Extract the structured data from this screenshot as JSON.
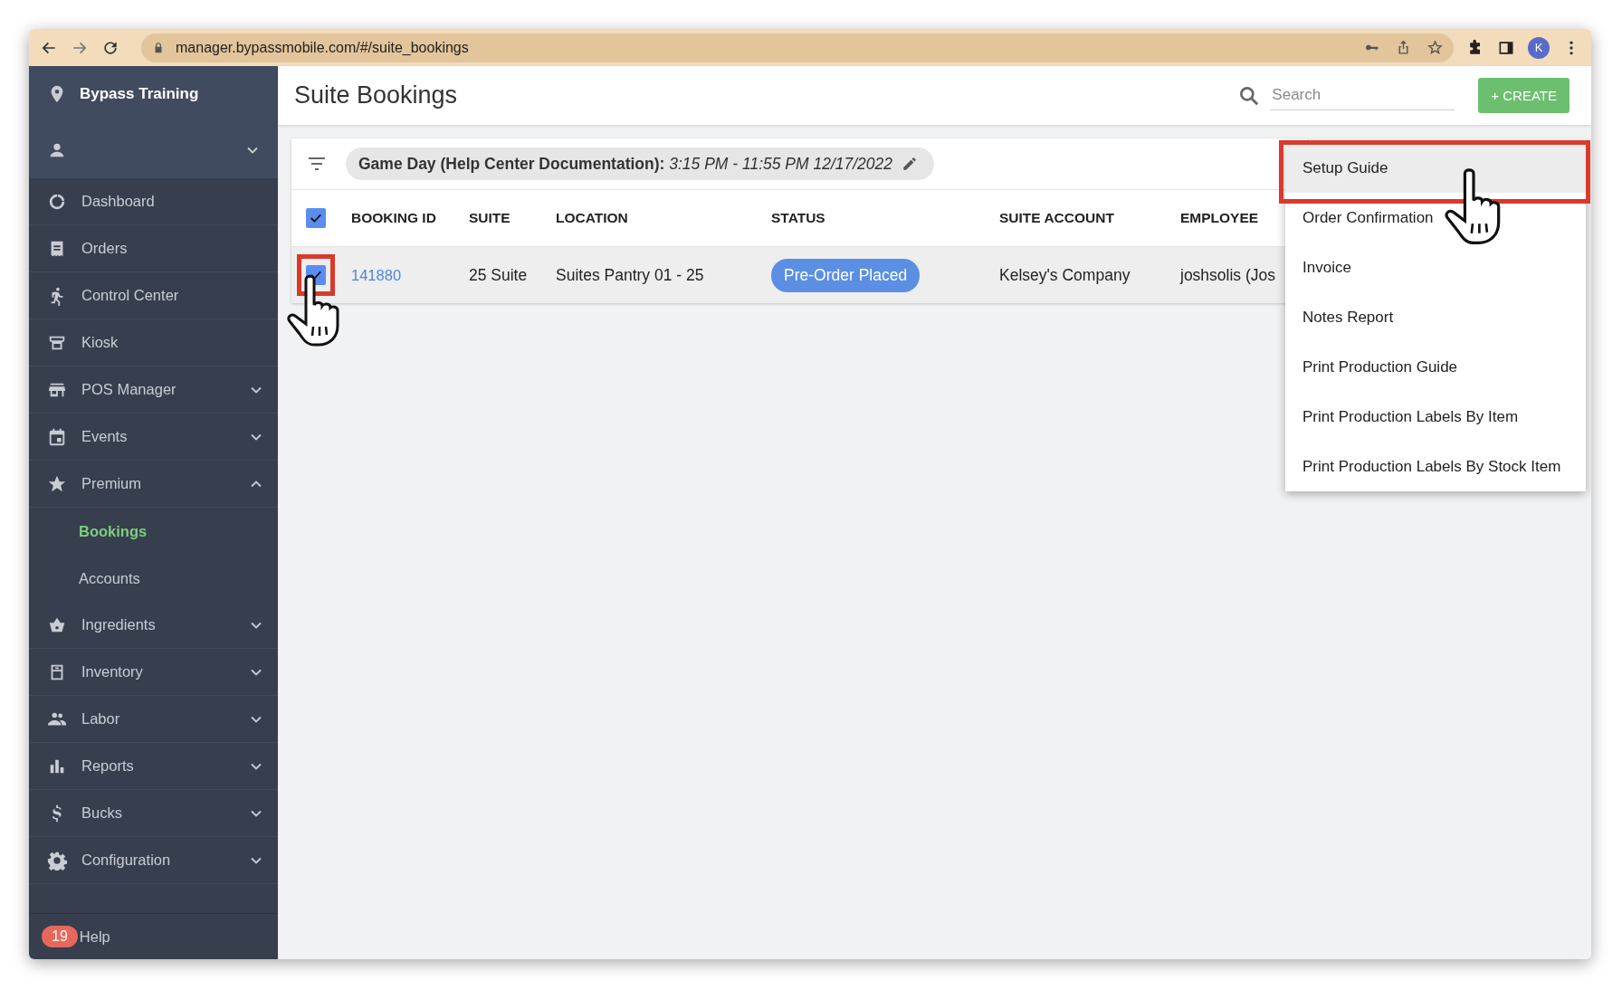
{
  "browser": {
    "url": "manager.bypassmobile.com/#/suite_bookings",
    "profile_initial": "K"
  },
  "sidebar": {
    "venue": "Bypass Training",
    "items": [
      {
        "label": "Dashboard"
      },
      {
        "label": "Orders"
      },
      {
        "label": "Control Center"
      },
      {
        "label": "Kiosk"
      },
      {
        "label": "POS Manager",
        "expanded": false
      },
      {
        "label": "Events",
        "expanded": false
      },
      {
        "label": "Premium",
        "expanded": true,
        "children": [
          {
            "label": "Bookings",
            "selected": true
          },
          {
            "label": "Accounts",
            "selected": false
          }
        ]
      },
      {
        "label": "Ingredients",
        "expanded": false
      },
      {
        "label": "Inventory",
        "expanded": false
      },
      {
        "label": "Labor",
        "expanded": false
      },
      {
        "label": "Reports",
        "expanded": false
      },
      {
        "label": "Bucks",
        "expanded": false
      },
      {
        "label": "Configuration",
        "expanded": false
      }
    ],
    "help": {
      "badge": "19",
      "label": "Help"
    }
  },
  "header": {
    "title": "Suite Bookings",
    "search": {
      "placeholder": "Search"
    },
    "create_button": "+ CREATE"
  },
  "filter": {
    "event": "Game Day (Help Center Documentation):",
    "time": "3:15 PM - 11:55 PM 12/17/2022"
  },
  "table": {
    "all_checked": true,
    "columns": [
      "BOOKING ID",
      "SUITE",
      "LOCATION",
      "STATUS",
      "SUITE ACCOUNT",
      "EMPLOYEE"
    ],
    "rows": [
      {
        "checked": true,
        "selected": true,
        "booking_id": "141880",
        "suite": "25 Suite",
        "location": "Suites Pantry 01 - 25",
        "status": "Pre-Order Placed",
        "suite_account": "Kelsey's Company",
        "employee": "joshsolis (Jos"
      }
    ]
  },
  "menu": {
    "items": [
      {
        "label": "Setup Guide",
        "selected": true
      },
      {
        "label": "Order Confirmation",
        "selected": false
      },
      {
        "label": "Invoice",
        "selected": false
      },
      {
        "label": "Notes Report",
        "selected": false
      },
      {
        "label": "Print Production Guide",
        "selected": false
      },
      {
        "label": "Print Production Labels By Item",
        "selected": false
      },
      {
        "label": "Print Production Labels By Stock Item",
        "selected": false
      }
    ]
  }
}
